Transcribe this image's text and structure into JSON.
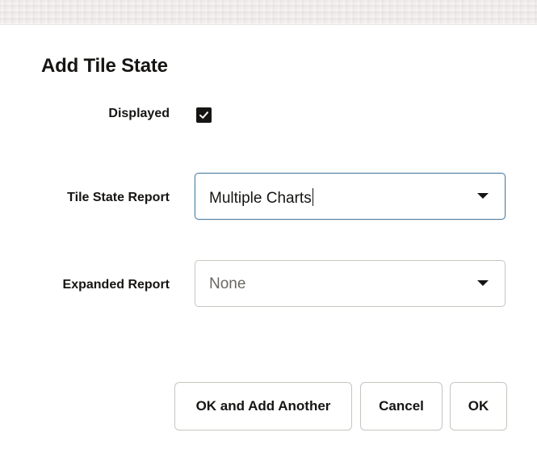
{
  "dialog": {
    "title": "Add Tile State"
  },
  "fields": {
    "displayed": {
      "label": "Displayed",
      "checked": true
    },
    "tile_state_report": {
      "label": "Tile State Report",
      "value": "Multiple Charts"
    },
    "expanded_report": {
      "label": "Expanded Report",
      "value": "None"
    }
  },
  "buttons": {
    "ok_and_add_another": "OK and Add Another",
    "cancel": "Cancel",
    "ok": "OK"
  },
  "icons": {
    "checkbox": "checkmark-icon",
    "dropdown": "chevron-down-icon"
  },
  "colors": {
    "text": "#161513",
    "border": "#c9c5c0",
    "focus_border": "#4f7fa3",
    "muted_text": "#6b6762"
  }
}
